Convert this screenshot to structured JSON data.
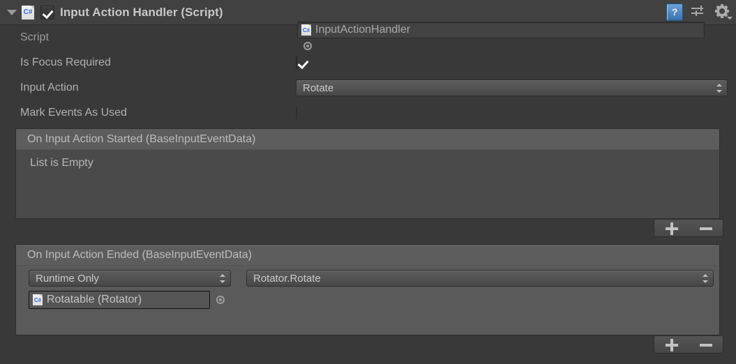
{
  "component": {
    "title": "Input Action Handler (Script)",
    "enabled": true,
    "foldout_open": true,
    "script_icon_label": "C#",
    "help_icon": "help-book-icon",
    "preset_icon": "preset-sliders-icon",
    "settings_icon": "gear-icon"
  },
  "properties": [
    {
      "label": "Script",
      "type": "object",
      "value": "InputActionHandler",
      "icon_label": "C#",
      "readonly": true
    },
    {
      "label": "Is Focus Required",
      "type": "checkbox",
      "checked": true
    },
    {
      "label": "Input Action",
      "type": "dropdown",
      "value": "Rotate"
    },
    {
      "label": "Mark Events As Used",
      "type": "checkbox",
      "checked": false
    }
  ],
  "events": [
    {
      "title": "On Input Action Started (BaseInputEventData)",
      "empty_message": "List is Empty",
      "entries": []
    },
    {
      "title": "On Input Action Ended (BaseInputEventData)",
      "empty_message": "",
      "entries": [
        {
          "call_state": "Runtime Only",
          "function": "Rotator.Rotate",
          "target_object": "Rotatable (Rotator)",
          "target_icon_label": "C#"
        }
      ]
    }
  ],
  "buttons": {
    "add_label": "+",
    "remove_label": "-"
  },
  "colors": {
    "panel_bg": "#393939",
    "header_bg": "#414141",
    "list_bar": "#5d5d5d",
    "list_body_empty": "#4a4a4a",
    "list_body_filled": "#5a5a5a",
    "text": "#b0b0b0",
    "accent_blue": "#3a6fa8"
  }
}
